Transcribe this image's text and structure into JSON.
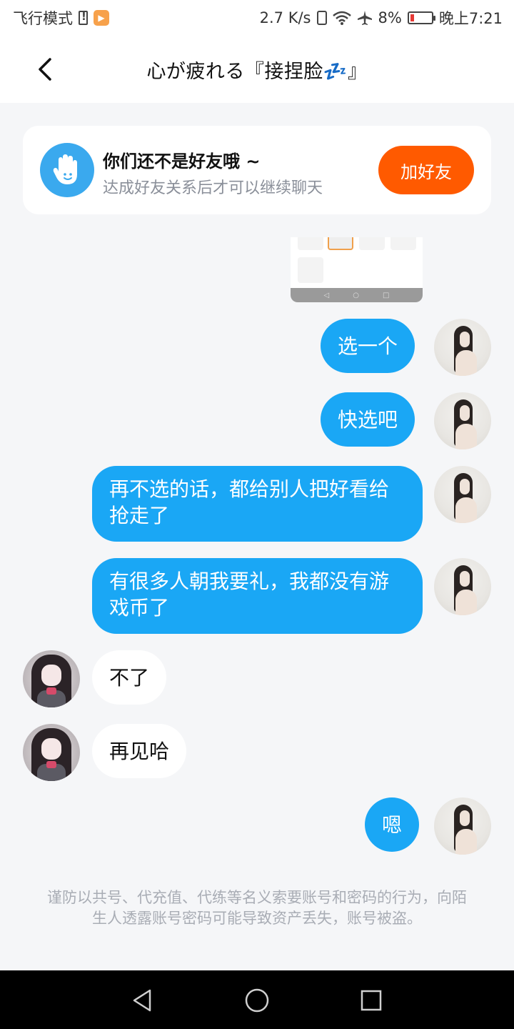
{
  "status_bar": {
    "mode": "飞行模式",
    "net_speed": "2.7 K/s",
    "battery": "8%",
    "time": "晚上7:21",
    "icons": [
      "sim-alert-icon",
      "app-notification-icon",
      "vibrate-icon",
      "wifi-icon",
      "airplane-icon",
      "battery-low-icon"
    ]
  },
  "header": {
    "title": "心が疲れる『接捏脸💤』",
    "back_icon": "chevron-left-icon"
  },
  "friend_banner": {
    "icon": "waving-hand-icon",
    "title": "你们还不是好友哦 ~",
    "subtitle": "达成好友关系后才可以继续聊天",
    "button": "加好友",
    "button_color": "#ff5a00"
  },
  "messages": [
    {
      "from": "self",
      "text": "选一个"
    },
    {
      "from": "self",
      "text": "快选吧"
    },
    {
      "from": "self",
      "text": "再不选的话，都给别人把好看给抢走了"
    },
    {
      "from": "self",
      "text": "有很多人朝我要礼，我都没有游戏币了"
    },
    {
      "from": "other",
      "text": "不了"
    },
    {
      "from": "other",
      "text": "再见哈"
    },
    {
      "from": "self",
      "text": "嗯"
    }
  ],
  "colors": {
    "self_bubble": "#1aa7f5",
    "other_bubble": "#ffffff",
    "background": "#f5f6f8"
  },
  "warning": "谨防以共号、代充值、代练等名义索要账号和密码的行为，向陌生人透露账号密码可能导致资产丢失，账号被盗。",
  "navbar": {
    "icons": [
      "back-triangle-icon",
      "home-circle-icon",
      "recents-square-icon"
    ]
  }
}
